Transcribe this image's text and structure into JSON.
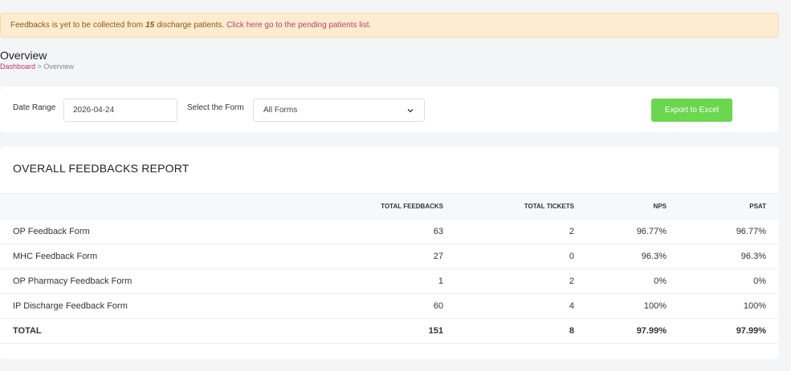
{
  "alert": {
    "prefix": "Feedbacks is yet to be collected from",
    "count": "15",
    "suffix": "discharge patients.",
    "link": "Click here go to the pending patients list."
  },
  "page": {
    "title": "Overview",
    "breadcrumb_link": "Dashboard",
    "breadcrumb_sep": ">",
    "breadcrumb_current": "Overview"
  },
  "filters": {
    "date_label": "Date Range",
    "date_value": "2026-04-24",
    "form_label": "Select the Form",
    "form_value": "All Forms",
    "export_label": "Export to Excel"
  },
  "report": {
    "title": "OVERALL FEEDBACKS REPORT",
    "columns": [
      "",
      "TOTAL FEEDBACKS",
      "TOTAL TICKETS",
      "NPS",
      "PSAT"
    ],
    "rows": [
      {
        "name": "OP Feedback Form",
        "feedbacks": "63",
        "tickets": "2",
        "nps": "96.77%",
        "psat": "96.77%"
      },
      {
        "name": "MHC Feedback Form",
        "feedbacks": "27",
        "tickets": "0",
        "nps": "96.3%",
        "psat": "96.3%"
      },
      {
        "name": "OP Pharmacy Feedback Form",
        "feedbacks": "1",
        "tickets": "2",
        "nps": "0%",
        "psat": "0%"
      },
      {
        "name": "IP Discharge Feedback Form",
        "feedbacks": "60",
        "tickets": "4",
        "nps": "100%",
        "psat": "100%"
      }
    ],
    "total": {
      "name": "TOTAL",
      "feedbacks": "151",
      "tickets": "8",
      "nps": "97.99%",
      "psat": "97.99%"
    }
  }
}
